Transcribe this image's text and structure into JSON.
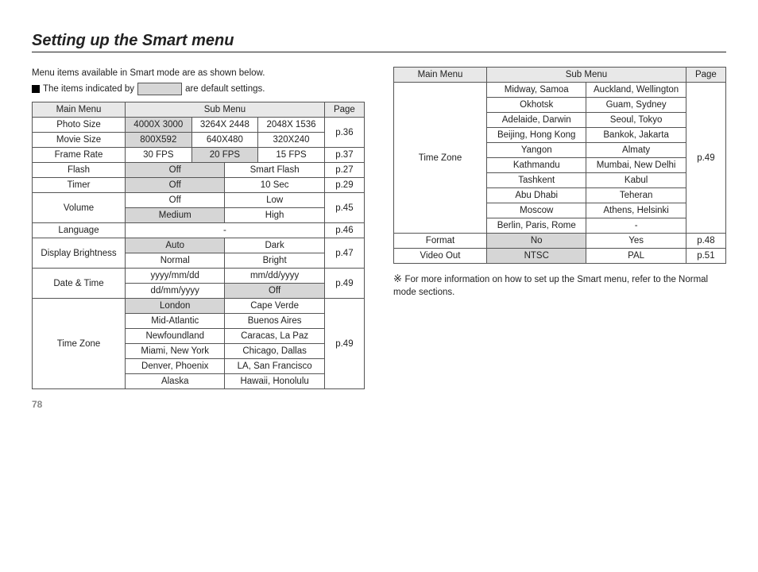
{
  "title": "Setting up the Smart menu",
  "intro": "Menu items available in Smart mode are as shown below.",
  "legend_prefix": "The items indicated by",
  "legend_suffix": "are default settings.",
  "headers": {
    "main": "Main Menu",
    "sub": "Sub Menu",
    "page": "Page"
  },
  "left": {
    "photosize_label": "Photo Size",
    "photosize_opts": [
      "4000X 3000",
      "3264X 2448",
      "2048X 1536"
    ],
    "moviesize_label": "Movie Size",
    "moviesize_opts": [
      "800X592",
      "640X480",
      "320X240"
    ],
    "moviesize_page": "p.36",
    "framerate_label": "Frame Rate",
    "framerate_opts": [
      "30 FPS",
      "20 FPS",
      "15 FPS"
    ],
    "framerate_page": "p.37",
    "flash_label": "Flash",
    "flash_opts": [
      "Off",
      "Smart Flash"
    ],
    "flash_page": "p.27",
    "timer_label": "Timer",
    "timer_opts": [
      "Off",
      "10 Sec"
    ],
    "timer_page": "p.29",
    "volume_label": "Volume",
    "volume_opts": [
      "Off",
      "Low",
      "Medium",
      "High"
    ],
    "volume_page": "p.45",
    "language_label": "Language",
    "language_opt": "-",
    "language_page": "p.46",
    "brightness_label": "Display  Brightness",
    "brightness_opts": [
      "Auto",
      "Dark",
      "Normal",
      "Bright"
    ],
    "brightness_page": "p.47",
    "datetime_label": "Date & Time",
    "datetime_opts": [
      "yyyy/mm/dd",
      "mm/dd/yyyy",
      "dd/mm/yyyy",
      "Off"
    ],
    "datetime_page": "p.49",
    "timezone_label": "Time Zone",
    "timezone_opts": [
      "London",
      "Cape Verde",
      "Mid-Atlantic",
      "Buenos Aires",
      "Newfoundland",
      "Caracas, La Paz",
      "Miami, New York",
      "Chicago, Dallas",
      "Denver, Phoenix",
      "LA, San Francisco",
      "Alaska",
      "Hawaii, Honolulu"
    ],
    "timezone_page": "p.49"
  },
  "right": {
    "timezone_label": "Time Zone",
    "timezone_opts": [
      "Midway, Samoa",
      "Auckland, Wellington",
      "Okhotsk",
      "Guam, Sydney",
      "Adelaide, Darwin",
      "Seoul, Tokyo",
      "Beijing, Hong Kong",
      "Bankok, Jakarta",
      "Yangon",
      "Almaty",
      "Kathmandu",
      "Mumbai, New Delhi",
      "Tashkent",
      "Kabul",
      "Abu Dhabi",
      "Teheran",
      "Moscow",
      "Athens, Helsinki",
      "Berlin, Paris, Rome",
      "-"
    ],
    "timezone_page": "p.49",
    "format_label": "Format",
    "format_opts": [
      "No",
      "Yes"
    ],
    "format_page": "p.48",
    "videoout_label": "Video Out",
    "videoout_opts": [
      "NTSC",
      "PAL"
    ],
    "videoout_page": "p.51"
  },
  "footnote": "For more information on how to set up the Smart menu, refer to the Normal mode sections.",
  "pagenum": "78"
}
